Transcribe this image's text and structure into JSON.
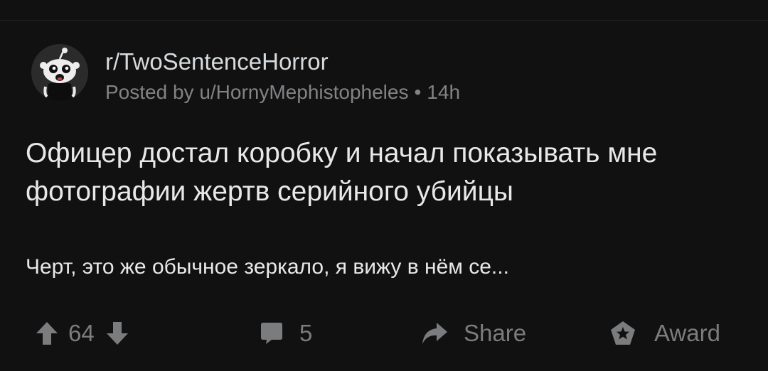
{
  "post": {
    "subreddit": "r/TwoSentenceHorror",
    "posted_by_prefix": "Posted by",
    "author": "u/HornyMephistopheles",
    "separator": "•",
    "age": "14h",
    "title": "Офицер достал коробку и начал показывать мне фотографии жертв серийного убийцы",
    "body_preview": "Черт, это же обычное зеркало, я вижу в нём се..."
  },
  "actions": {
    "vote_count": "64",
    "comment_count": "5",
    "share_label": "Share",
    "award_label": "Award"
  },
  "icons": {
    "avatar": "subreddit-avatar-icon",
    "upvote": "upvote-arrow-icon",
    "downvote": "downvote-arrow-icon",
    "comment": "comment-bubble-icon",
    "share": "share-arrow-icon",
    "award": "award-badge-icon"
  },
  "colors": {
    "background": "#111112",
    "text_primary": "#e8e8e8",
    "text_secondary": "#818384",
    "icon_muted": "#7a7c7e"
  }
}
